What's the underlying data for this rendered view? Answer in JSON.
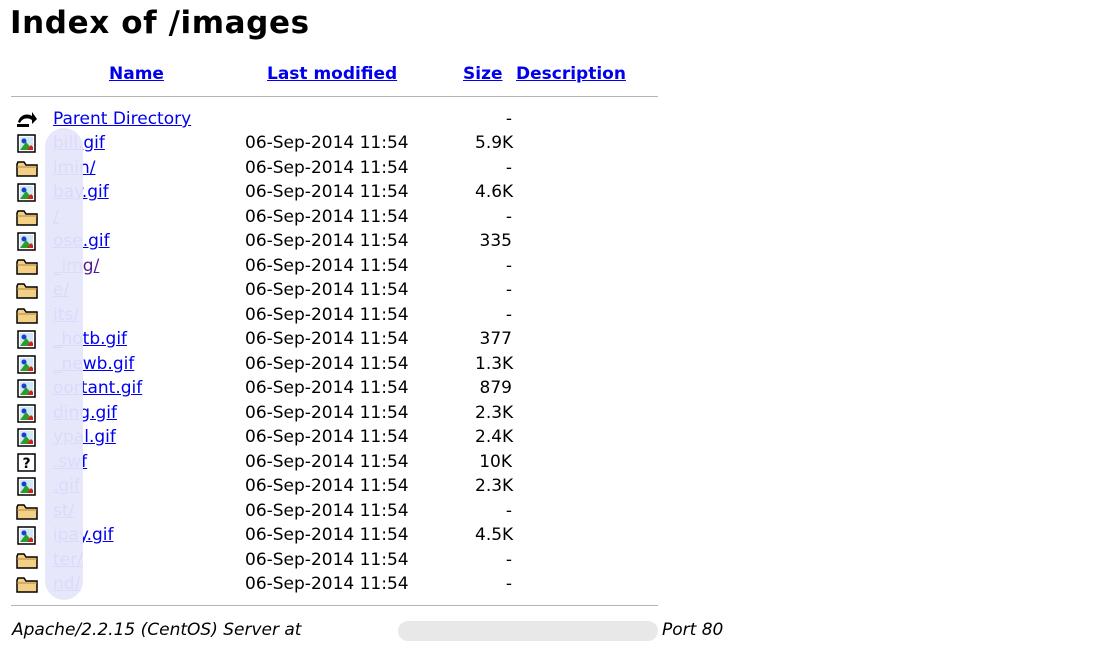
{
  "title": "Index of /images",
  "columns": {
    "name": "Name",
    "last_modified": "Last modified",
    "size": "Size",
    "description": "Description"
  },
  "parent": {
    "label": "Parent Directory",
    "size": "-",
    "icon": "back-arrow-icon"
  },
  "rows": [
    {
      "name": "bill.gif",
      "date": "06-Sep-2014 11:54",
      "size": "5.9K",
      "icon": "image-file-icon"
    },
    {
      "name": "lmin/",
      "date": "06-Sep-2014 11:54",
      "size": "-",
      "icon": "folder-icon"
    },
    {
      "name": "bay.gif",
      "date": "06-Sep-2014 11:54",
      "size": "4.6K",
      "icon": "image-file-icon"
    },
    {
      "name": "/",
      "date": "06-Sep-2014 11:54",
      "size": "-",
      "icon": "folder-icon"
    },
    {
      "name": "ose.gif",
      "date": "06-Sep-2014 11:54",
      "size": "335",
      "icon": "image-file-icon"
    },
    {
      "name": "_img/",
      "date": "06-Sep-2014 11:54",
      "size": "-",
      "icon": "folder-icon",
      "visited": true
    },
    {
      "name": "e/",
      "date": "06-Sep-2014 11:54",
      "size": "-",
      "icon": "folder-icon"
    },
    {
      "name": "its/",
      "date": "06-Sep-2014 11:54",
      "size": "-",
      "icon": "folder-icon"
    },
    {
      "name": "_hotb.gif",
      "date": "06-Sep-2014 11:54",
      "size": "377",
      "icon": "image-file-icon"
    },
    {
      "name": "_newb.gif",
      "date": "06-Sep-2014 11:54",
      "size": "1.3K",
      "icon": "image-file-icon"
    },
    {
      "name": "oortant.gif",
      "date": "06-Sep-2014 11:54",
      "size": "879",
      "icon": "image-file-icon"
    },
    {
      "name": "ding.gif",
      "date": "06-Sep-2014 11:54",
      "size": "2.3K",
      "icon": "image-file-icon"
    },
    {
      "name": "ypal.gif",
      "date": "06-Sep-2014 11:54",
      "size": "2.4K",
      "icon": "image-file-icon"
    },
    {
      "name": ".swf",
      "date": "06-Sep-2014 11:54",
      "size": "10K",
      "icon": "unknown-file-icon"
    },
    {
      "name": ".gif",
      "date": "06-Sep-2014 11:54",
      "size": "2.3K",
      "icon": "image-file-icon"
    },
    {
      "name": "st/",
      "date": "06-Sep-2014 11:54",
      "size": "-",
      "icon": "folder-icon"
    },
    {
      "name": "ipay.gif",
      "date": "06-Sep-2014 11:54",
      "size": "4.5K",
      "icon": "image-file-icon"
    },
    {
      "name": "ter/",
      "date": "06-Sep-2014 11:54",
      "size": "-",
      "icon": "folder-icon"
    },
    {
      "name": "nd/",
      "date": "06-Sep-2014 11:54",
      "size": "-",
      "icon": "folder-icon"
    }
  ],
  "footer": {
    "server": "Apache/2.2.15 (CentOS) Server at",
    "port": "Port 80"
  },
  "colors": {
    "link": "#0000ee",
    "visited_link": "#551a8b",
    "folder_fill": "#f4cf86",
    "redaction": "#e6e6fb"
  }
}
